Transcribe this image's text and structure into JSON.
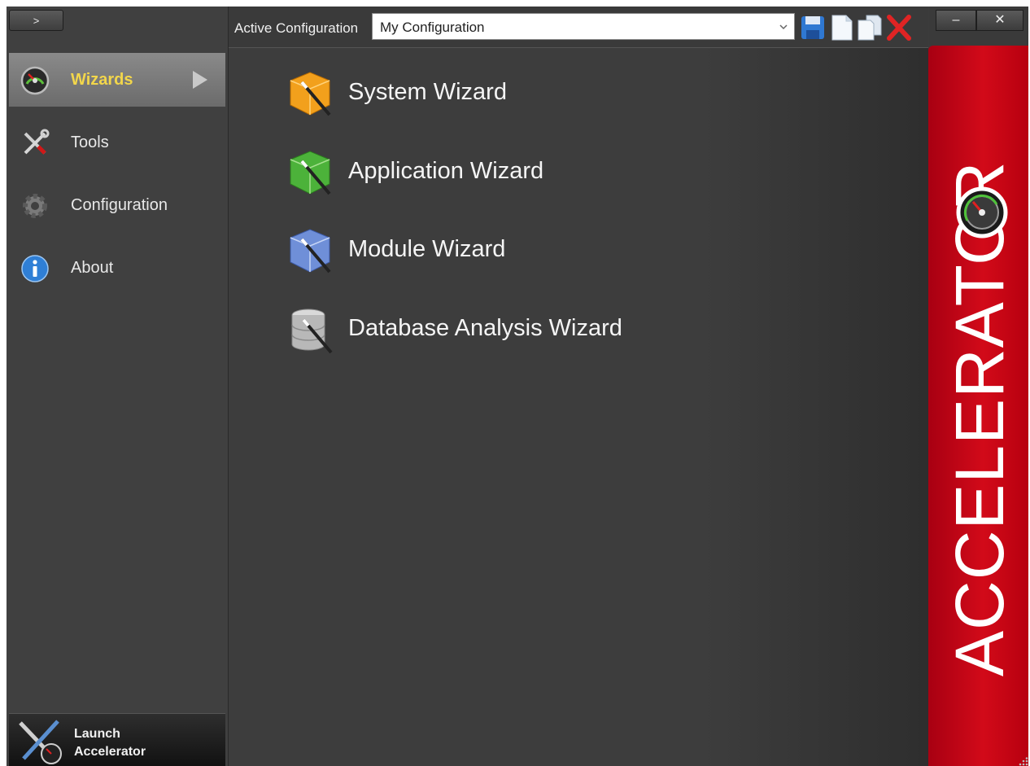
{
  "sidebar": {
    "expand_label": ">",
    "items": [
      {
        "label": "Wizards",
        "icon": "speedometer-icon",
        "active": true
      },
      {
        "label": "Tools",
        "icon": "tools-icon",
        "active": false
      },
      {
        "label": "Configuration",
        "icon": "gear-icon",
        "active": false
      },
      {
        "label": "About",
        "icon": "info-icon",
        "active": false
      }
    ],
    "launch": {
      "line1": "Launch",
      "line2": "Accelerator",
      "icon": "launch-accelerator-icon"
    }
  },
  "toolbar": {
    "active_config_label": "Active Configuration",
    "config_value": "My Configuration",
    "buttons": [
      "save-icon",
      "new-document-icon",
      "copy-icon",
      "delete-icon"
    ]
  },
  "window": {
    "minimize_label": "–",
    "close_label": "✕"
  },
  "wizards": [
    {
      "label": "System Wizard",
      "icon": "system-wizard-icon",
      "color": "#f2a01c"
    },
    {
      "label": "Application Wizard",
      "icon": "application-wizard-icon",
      "color": "#4cb23a"
    },
    {
      "label": "Module Wizard",
      "icon": "module-wizard-icon",
      "color": "#6f8fd8"
    },
    {
      "label": "Database Analysis Wizard",
      "icon": "database-wizard-icon",
      "color": "#b8b8b8"
    }
  ],
  "brand": {
    "word": "ACCELERATOR",
    "color": "#d20a19"
  },
  "colors": {
    "accent_active": "#f2d64b",
    "background": "#3b3b3b"
  }
}
